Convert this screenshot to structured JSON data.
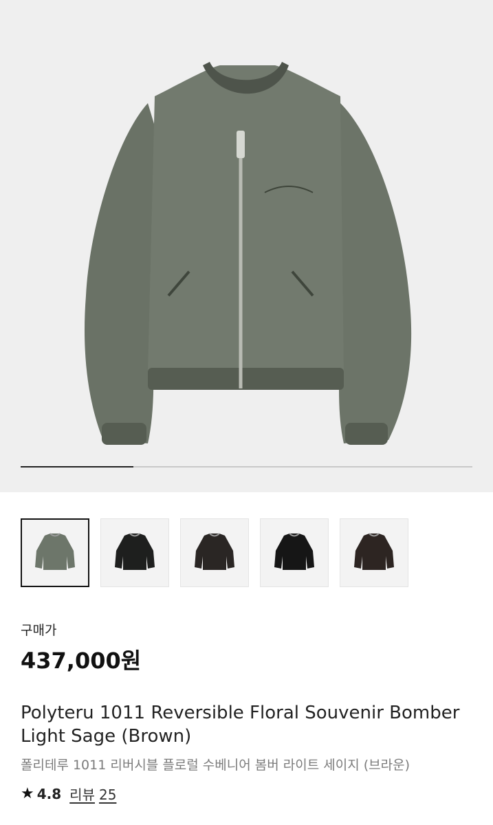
{
  "gallery": {
    "current_index": 1,
    "total": 4,
    "progress_fraction": 0.25,
    "thumbnails": [
      {
        "name": "thumb-light-sage",
        "color": "#6d766a",
        "selected": true
      },
      {
        "name": "thumb-black",
        "color": "#1e1f1e",
        "selected": false
      },
      {
        "name": "thumb-dark-brown-floral",
        "color": "#2a2624",
        "selected": false
      },
      {
        "name": "thumb-black-velvet",
        "color": "#161616",
        "selected": false
      },
      {
        "name": "thumb-brown",
        "color": "#2d2522",
        "selected": false
      }
    ]
  },
  "product": {
    "price_label": "구매가",
    "price": "437,000원",
    "title_en": "Polyteru 1011 Reversible Floral Souvenir Bomber Light Sage (Brown)",
    "title_ko": "폴리테루 1011 리버시블 플로럴 수베니어 봄버 라이트 세이지 (브라운)",
    "rating": "4.8",
    "review_label": "리뷰",
    "review_count": "25"
  },
  "icons": {
    "star": "star-icon"
  },
  "colors": {
    "jacket": "#6b7368",
    "hero_bg": "#efefef"
  }
}
